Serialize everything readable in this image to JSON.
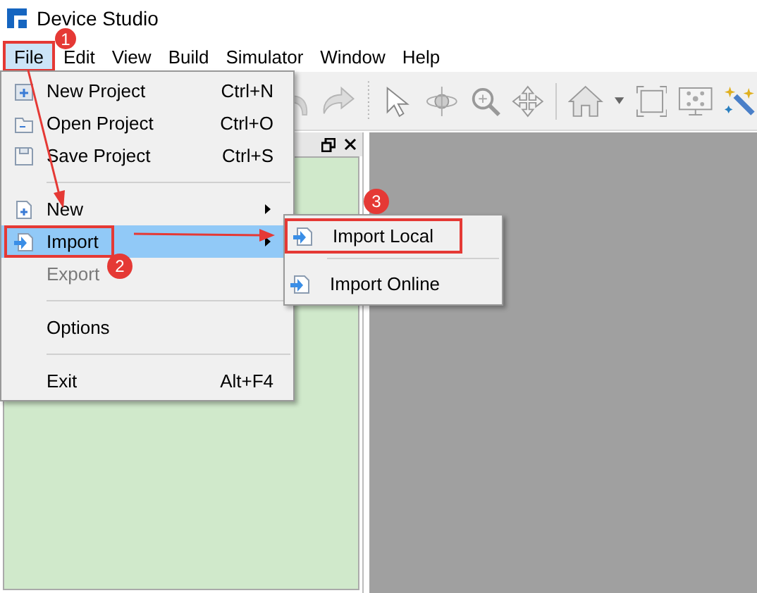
{
  "window": {
    "title": "Device Studio"
  },
  "menu_bar": [
    {
      "label": "File",
      "selected": true
    },
    {
      "label": "Edit",
      "selected": false
    },
    {
      "label": "View",
      "selected": false
    },
    {
      "label": "Build",
      "selected": false
    },
    {
      "label": "Simulator",
      "selected": false
    },
    {
      "label": "Window",
      "selected": false
    },
    {
      "label": "Help",
      "selected": false
    }
  ],
  "file_menu": [
    {
      "kind": "item",
      "label": "New Project",
      "shortcut": "Ctrl+N",
      "selected": false,
      "disabled": false
    },
    {
      "kind": "item",
      "label": "Open Project",
      "shortcut": "Ctrl+O",
      "selected": false,
      "disabled": false
    },
    {
      "kind": "item",
      "label": "Save Project",
      "shortcut": "Ctrl+S",
      "selected": false,
      "disabled": false
    },
    {
      "kind": "separator"
    },
    {
      "kind": "submenu",
      "label": "New",
      "selected": false,
      "disabled": false
    },
    {
      "kind": "submenu",
      "label": "Import",
      "selected": true,
      "disabled": false
    },
    {
      "kind": "item",
      "label": "Export",
      "selected": false,
      "disabled": true
    },
    {
      "kind": "separator"
    },
    {
      "kind": "item",
      "label": "Options",
      "selected": false,
      "disabled": false
    },
    {
      "kind": "separator"
    },
    {
      "kind": "item",
      "label": "Exit",
      "shortcut": "Alt+F4",
      "selected": false,
      "disabled": false
    }
  ],
  "import_submenu": [
    {
      "kind": "item",
      "label": "Import Local"
    },
    {
      "kind": "separator"
    },
    {
      "kind": "item",
      "label": "Import Online"
    }
  ],
  "annotations": [
    {
      "label": "1"
    },
    {
      "label": "2"
    },
    {
      "label": "3"
    }
  ]
}
